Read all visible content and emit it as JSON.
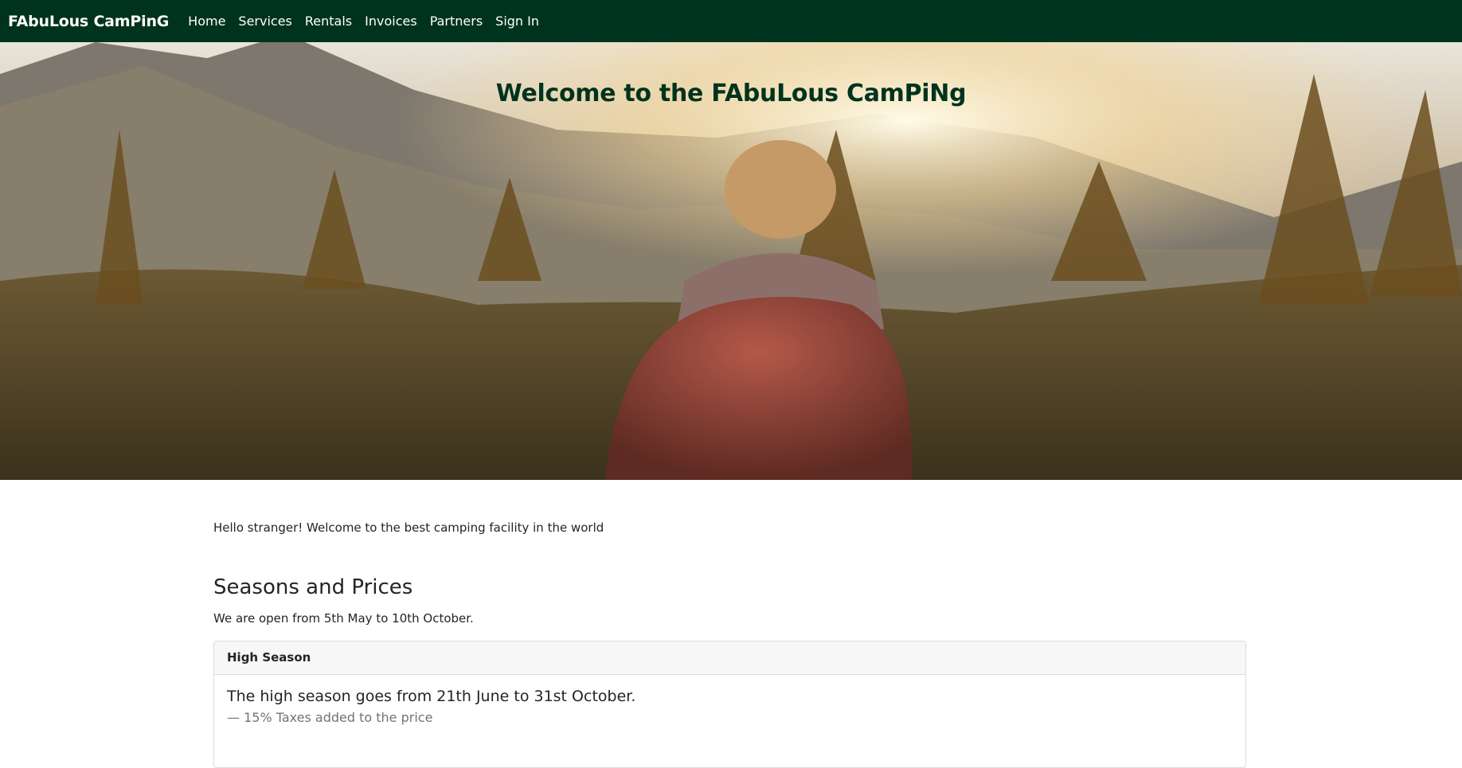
{
  "navbar": {
    "brand": "FAbuLous CamPinG",
    "links": [
      "Home",
      "Services",
      "Rentals",
      "Invoices",
      "Partners",
      "Sign In"
    ]
  },
  "hero": {
    "title": "Welcome to the FAbuLous CamPiNg"
  },
  "main": {
    "intro": "Hello stranger! Welcome to the best camping facility in the world",
    "section_title": "Seasons and Prices",
    "open_text": "We are open from 5th May to 10th October.",
    "card": {
      "header": "High Season",
      "text": "The high season goes from 21th June to 31st October.",
      "footer": "— 15% Taxes added to the price"
    }
  },
  "colors": {
    "navbar_bg": "#00331d",
    "hero_title": "#00331d"
  }
}
